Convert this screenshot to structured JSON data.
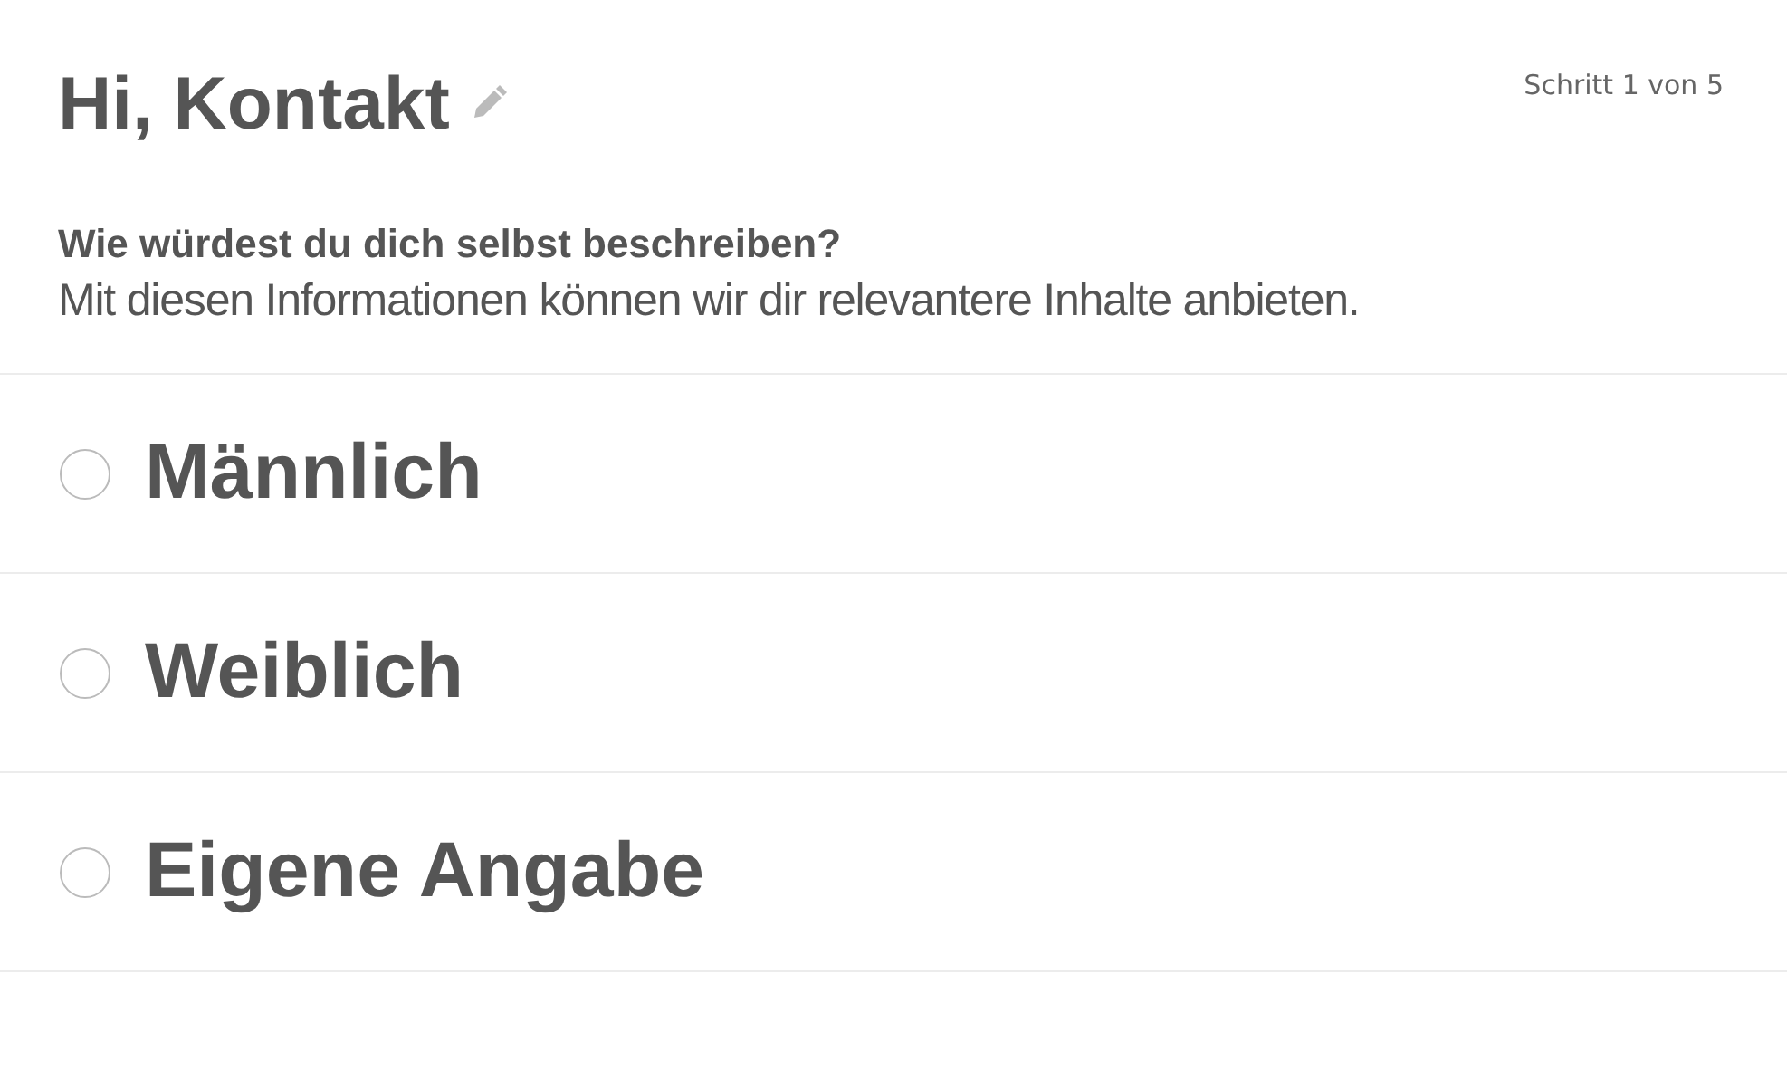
{
  "header": {
    "title": "Hi, Kontakt",
    "step": "Schritt 1 von 5"
  },
  "question": {
    "title": "Wie würdest du dich selbst beschreiben?",
    "description": "Mit diesen Informationen können wir dir relevantere Inhalte anbieten."
  },
  "options": [
    {
      "label": "Männlich",
      "selected": false
    },
    {
      "label": "Weiblich",
      "selected": false
    },
    {
      "label": "Eigene Angabe",
      "selected": false
    }
  ]
}
